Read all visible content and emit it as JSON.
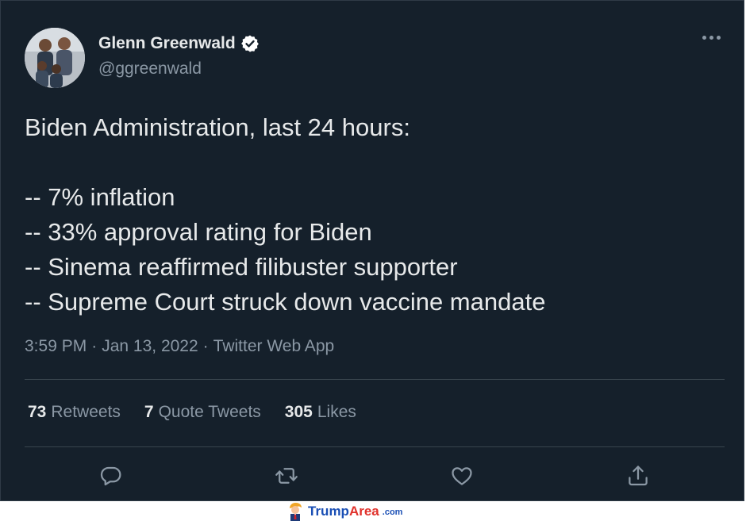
{
  "author": {
    "display_name": "Glenn Greenwald",
    "handle": "@ggreenwald",
    "verified": true
  },
  "tweet": {
    "lines": [
      "Biden Administration, last 24 hours:",
      "",
      "-- 7% inflation",
      "-- 33% approval rating for Biden",
      "-- Sinema reaffirmed filibuster supporter",
      "-- Supreme Court struck down vaccine mandate"
    ],
    "time": "3:59 PM",
    "date": "Jan 13, 2022",
    "separator": "·",
    "source": "Twitter Web App"
  },
  "stats": {
    "retweets_count": "73",
    "retweets_label": "Retweets",
    "quotes_count": "7",
    "quotes_label": "Quote Tweets",
    "likes_count": "305",
    "likes_label": "Likes"
  },
  "actions": [
    {
      "name": "reply",
      "icon": "reply-icon"
    },
    {
      "name": "retweet",
      "icon": "retweet-icon"
    },
    {
      "name": "like",
      "icon": "heart-icon"
    },
    {
      "name": "share",
      "icon": "share-icon"
    }
  ],
  "watermark": {
    "brand_part1": "Trump",
    "brand_part2": "Area",
    "tld": ".com"
  },
  "colors": {
    "background": "#15202b",
    "text_primary": "#e7e9ea",
    "text_secondary": "#8b98a5",
    "divider": "#38444d",
    "verified_badge": "#ffffff"
  }
}
